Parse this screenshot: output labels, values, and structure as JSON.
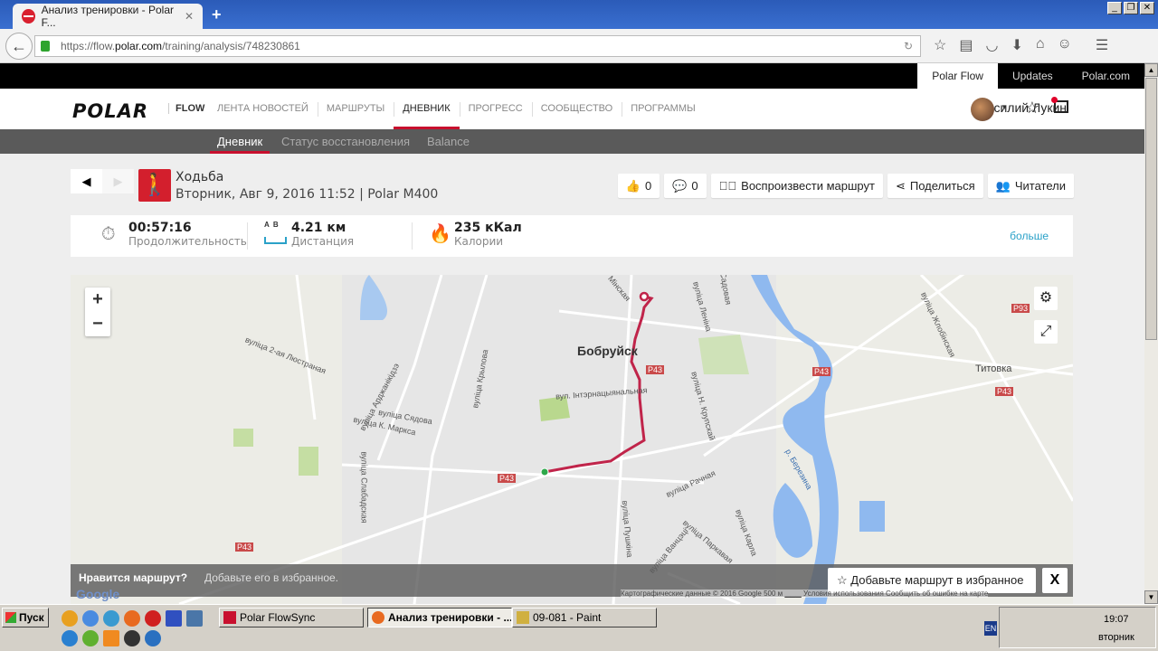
{
  "browser": {
    "tab_title": "Анализ тренировки - Polar F...",
    "url_prefix": "https://flow.",
    "url_domain": "polar.com",
    "url_path": "/training/analysis/748230861"
  },
  "toplinks": [
    "Polar Flow",
    "Updates",
    "Polar.com"
  ],
  "nav": {
    "logo": "POLAR",
    "flow": "FLOW",
    "items": [
      "ЛЕНТА НОВОСТЕЙ",
      "МАРШРУТЫ",
      "ДНЕВНИК",
      "ПРОГРЕСС",
      "СООБЩЕСТВО",
      "ПРОГРАММЫ"
    ],
    "active": "ДНЕВНИК",
    "user": "Василий Лукин"
  },
  "subnav": [
    "Дневник",
    "Статус восстановления",
    "Balance"
  ],
  "training": {
    "sport": "Ходьба",
    "details": "Вторник, Авг 9, 2016 11:52 | Polar M400"
  },
  "actions": {
    "likes": "0",
    "comments": "0",
    "replay": "Воспроизвести маршрут",
    "share": "Поделиться",
    "followers": "Читатели"
  },
  "summary": {
    "duration": "00:57:16",
    "duration_label": "Продолжительность",
    "distance": "4.21 км",
    "distance_label": "Дистанция",
    "distance_ab": "A  B",
    "calories": "235 кКал",
    "calories_label": "Калории",
    "more": "больше"
  },
  "map": {
    "city": "Бобруйск",
    "village": "Титовка",
    "river": "р. Березина",
    "roads": [
      "Р43",
      "Р43",
      "Р43",
      "Р43",
      "Р43",
      "Р93"
    ],
    "streets": [
      "вуліца 2-ая Люстраная",
      "вуліца Арджанікідзэ",
      "вуліца Сядова",
      "вуліца К. Маркса",
      "вуліца Слабадская",
      "вуліца Крылова",
      "вул. Інтэрнацыянальная",
      "вуліца Леніна",
      "Мінская",
      "вуліца Н. Крупскай",
      "вуліца Рачная",
      "вуліца Пушкіна",
      "вуліца Паркавая",
      "вуліца Ванцэці",
      "вуліца Карла",
      "вуліца Жлобінская",
      "Садовая"
    ],
    "prompt_q": "Нравится маршрут?",
    "prompt_hint": "Добавьте его в избранное.",
    "fav_button": "Добавьте маршрут в избранное",
    "close": "X",
    "attribution": "Картографические данные © 2016 Google   500 м ▁▁▁   Условия использования   Сообщить об ошибке на карте",
    "google": "Google",
    "route_color": "#c0244a"
  },
  "taskbar": {
    "start": "Пуск",
    "windows": [
      "Polar FlowSync",
      "Анализ тренировки - ...",
      "09-081 - Paint"
    ],
    "lang": "EN",
    "time": "19:07",
    "day": "вторник"
  },
  "colors": {
    "accent": "#c8102e",
    "link": "#2aa1c8"
  }
}
